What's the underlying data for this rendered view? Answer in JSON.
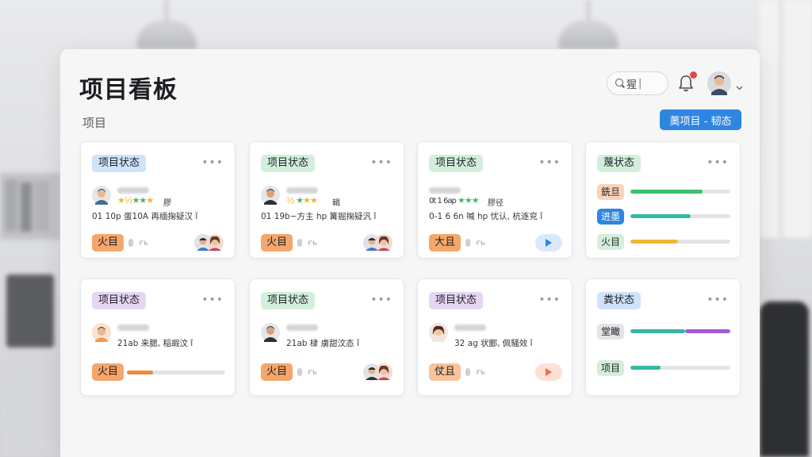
{
  "header": {
    "title": "项目看板",
    "subtitle": "项目",
    "search_text": "猩",
    "action_button": "薁项目 - 韧态"
  },
  "colors": {
    "blue_tag": "#cfe3fa",
    "green_tag": "#d3efdc",
    "purple_tag": "#e6d6f4",
    "orange_badge": "#f5a66a",
    "green_bar": "#3fbf6d",
    "teal_bar": "#35b8a6",
    "yellow_bar": "#f2b632",
    "purple_bar": "#a45ad6",
    "orange_bar": "#f08a3e",
    "primary_button": "#2f86e0"
  },
  "cards": [
    {
      "tag": "项目状态",
      "stars_note": "膠",
      "line": "01 10p 蛋10A 再缅掬疑汉 ǐ",
      "badge": "火目",
      "mini": "ᗁᑲ"
    },
    {
      "tag": "项目状态",
      "stars_note": "輯",
      "line": "01 19b−方主 hp 篝掘掬疑汎 ǐ",
      "badge": "火目",
      "mini": "ᗁᑲ"
    },
    {
      "tag": "项目状态",
      "stars_note": "膠径",
      "line": "0-1 6 6n 喊 hp 忧认, 杭逐兖 ǐ",
      "badge": "大且",
      "mini": "ᗁᑲ"
    },
    {
      "tag": "蔑状态",
      "rows": [
        {
          "label": "銑旦",
          "progress": 0.72
        },
        {
          "label": "进墨",
          "progress": 0.6
        },
        {
          "label": "火目",
          "progress": 0.48
        }
      ]
    },
    {
      "tag": "项目状态",
      "line": "21ab 来腮,  稲嘏汶 ǐ",
      "badge": "火目",
      "progress": 0.27
    },
    {
      "tag": "项目状态",
      "line": "21ab 棣  虜甜汶态 ǐ",
      "badge": "火目",
      "mini": "ᗁᑲ"
    },
    {
      "tag": "项目状态",
      "line": "32 ag 状郾,  佩騒效 ǐ",
      "badge": "仗且",
      "mini": "ᗁᑲ"
    },
    {
      "tag": "粪状态",
      "rows": [
        {
          "label": "堂瞰",
          "progress": 0.55,
          "progress2": 0.45
        },
        {
          "label": "项目",
          "progress": 0.3
        }
      ]
    }
  ]
}
